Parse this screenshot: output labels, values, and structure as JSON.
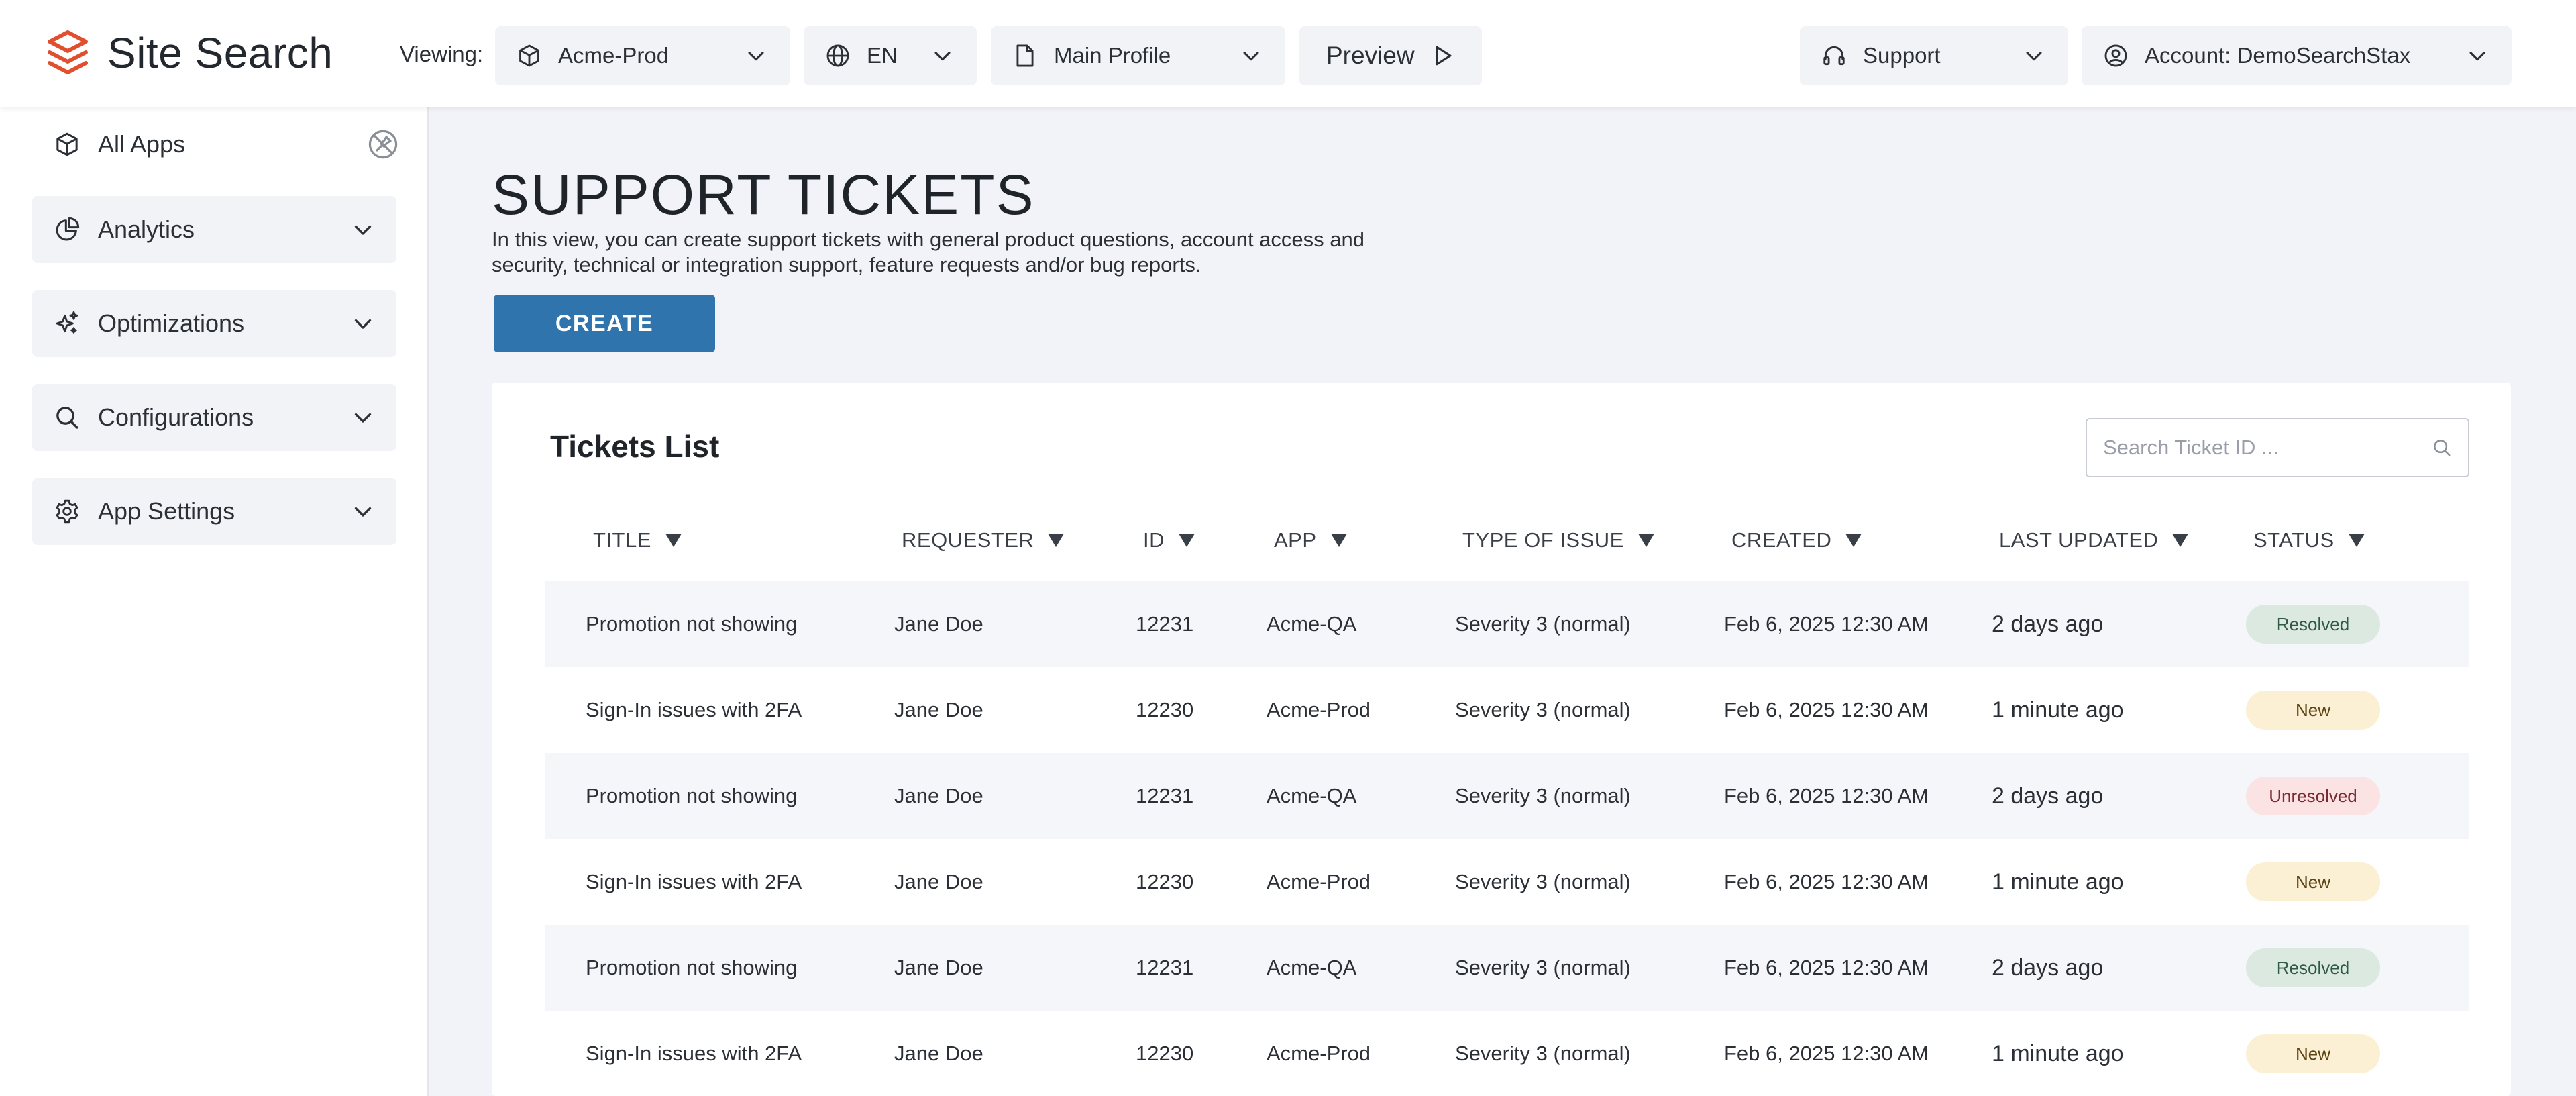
{
  "brand": {
    "name": "Site Search",
    "color": "#e0502f"
  },
  "header": {
    "viewing_label": "Viewing:",
    "app_select": {
      "value": "Acme-Prod",
      "icon": "cube-icon"
    },
    "language_select": {
      "value": "EN",
      "icon": "globe-icon"
    },
    "profile_select": {
      "value": "Main Profile",
      "icon": "file-icon"
    },
    "preview_label": "Preview",
    "support_select": {
      "value": "Support",
      "icon": "headset-icon"
    },
    "account_select": {
      "value": "Account: DemoSearchStax",
      "icon": "user-circle-icon"
    }
  },
  "sidebar": {
    "all_apps_label": "All Apps",
    "items": [
      {
        "label": "Analytics",
        "icon": "pie-chart-icon"
      },
      {
        "label": "Optimizations",
        "icon": "sparkle-icon"
      },
      {
        "label": "Configurations",
        "icon": "search-icon"
      },
      {
        "label": "App Settings",
        "icon": "gear-icon"
      }
    ]
  },
  "page": {
    "title": "SUPPORT TICKETS",
    "description": "In this view, you can create support tickets with general product questions, account access and security, technical or integration support, feature requests and/or bug reports.",
    "create_label": "CREATE"
  },
  "tickets": {
    "title": "Tickets List",
    "search_placeholder": "Search Ticket ID ...",
    "columns": [
      "TITLE",
      "REQUESTER",
      "ID",
      "APP",
      "TYPE OF ISSUE",
      "CREATED",
      "LAST UPDATED",
      "STATUS"
    ],
    "rows": [
      {
        "title": "Promotion not showing",
        "requester": "Jane Doe",
        "id": "12231",
        "app": "Acme-QA",
        "type": "Severity 3 (normal)",
        "created": "Feb 6, 2025 12:30 AM",
        "updated": "2 days ago",
        "status": "Resolved",
        "status_kind": "resolved"
      },
      {
        "title": "Sign-In issues with 2FA",
        "requester": "Jane Doe",
        "id": "12230",
        "app": "Acme-Prod",
        "type": "Severity 3 (normal)",
        "created": "Feb 6, 2025 12:30 AM",
        "updated": "1 minute ago",
        "status": "New",
        "status_kind": "new"
      },
      {
        "title": "Promotion not showing",
        "requester": "Jane Doe",
        "id": "12231",
        "app": "Acme-QA",
        "type": "Severity 3 (normal)",
        "created": "Feb 6, 2025 12:30 AM",
        "updated": "2 days ago",
        "status": "Unresolved",
        "status_kind": "unresolved"
      },
      {
        "title": "Sign-In issues with 2FA",
        "requester": "Jane Doe",
        "id": "12230",
        "app": "Acme-Prod",
        "type": "Severity 3 (normal)",
        "created": "Feb 6, 2025 12:30 AM",
        "updated": "1 minute ago",
        "status": "New",
        "status_kind": "new"
      },
      {
        "title": "Promotion not showing",
        "requester": "Jane Doe",
        "id": "12231",
        "app": "Acme-QA",
        "type": "Severity 3 (normal)",
        "created": "Feb 6, 2025 12:30 AM",
        "updated": "2 days ago",
        "status": "Resolved",
        "status_kind": "resolved"
      },
      {
        "title": "Sign-In issues with 2FA",
        "requester": "Jane Doe",
        "id": "12230",
        "app": "Acme-Prod",
        "type": "Severity 3 (normal)",
        "created": "Feb 6, 2025 12:30 AM",
        "updated": "1 minute ago",
        "status": "New",
        "status_kind": "new"
      }
    ]
  },
  "colors": {
    "primary_button": "#2f74ac",
    "resolved_badge": "#dbe9e1",
    "new_badge": "#fbf0d4",
    "unresolved_badge": "#fbe3e4"
  }
}
